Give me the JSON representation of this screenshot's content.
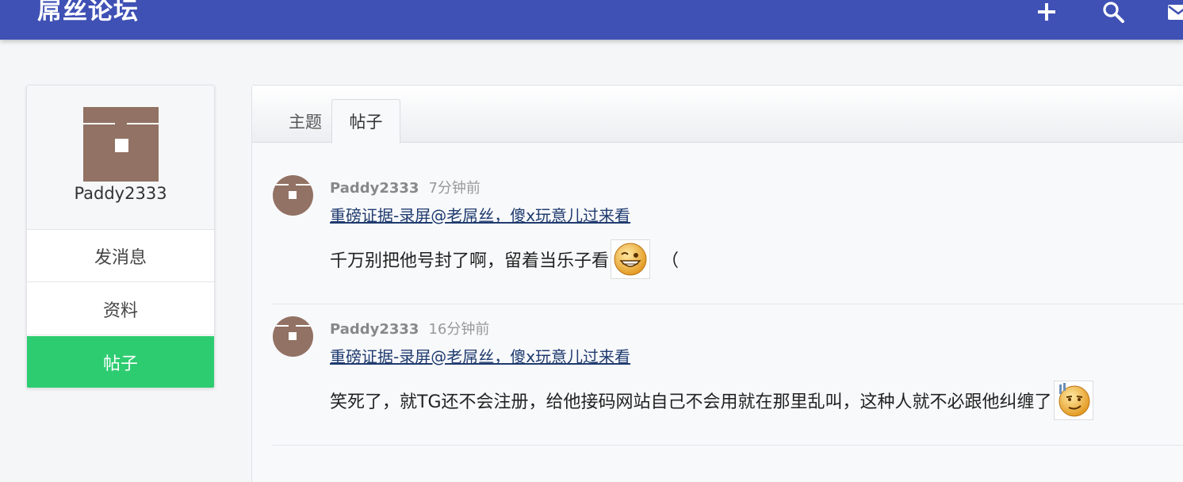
{
  "header": {
    "brand": "屌丝论坛",
    "icons": [
      "plus-icon",
      "search-icon",
      "mail-icon"
    ],
    "bg_color": "#3f51b5"
  },
  "sidebar": {
    "username": "Paddy2333",
    "avatar_color": "#927264",
    "menu": [
      {
        "label": "发消息",
        "active": false
      },
      {
        "label": "资料",
        "active": false
      },
      {
        "label": "帖子",
        "active": true
      }
    ],
    "active_color": "#2ecc71"
  },
  "tabs": [
    {
      "label": "主题",
      "active": false
    },
    {
      "label": "帖子",
      "active": true
    }
  ],
  "posts": [
    {
      "author": "Paddy2333",
      "time": "7分钟前",
      "thread": "重磅证据-录屏@老屌丝，傻x玩意儿过来看",
      "body": "千万别把他号封了啊，留着当乐子看",
      "emoji": "grinning-wink-emoji",
      "tail": "（"
    },
    {
      "author": "Paddy2333",
      "time": "16分钟前",
      "thread": "重磅证据-录屏@老屌丝，傻x玩意儿过来看",
      "body": "笑死了，就TG还不会注册，给他接码网站自己不会用就在那里乱叫，这种人就不必跟他纠缠了",
      "emoji": "smirk-emoji",
      "tail": ""
    }
  ]
}
